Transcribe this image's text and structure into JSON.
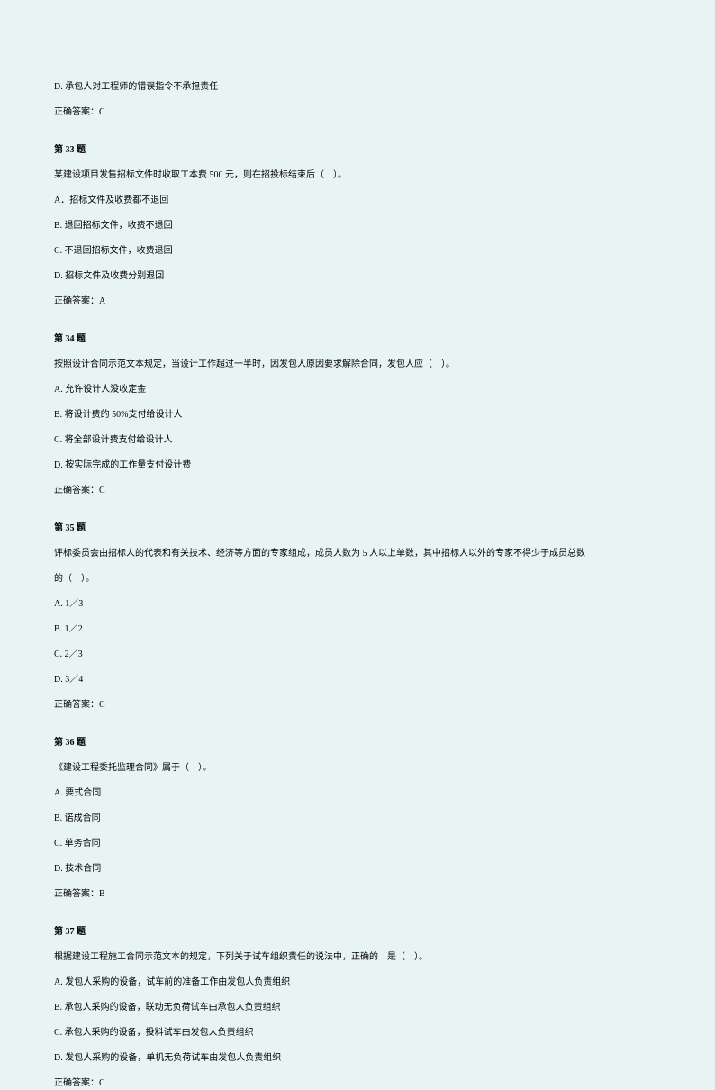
{
  "intro": {
    "optionD": "D. 承包人对工程师的错误指令不承担责任",
    "answer": "正确答案：C"
  },
  "q33": {
    "header": "第 33 题",
    "stem": "某建设项目发售招标文件时收取工本费 500 元，则在招投标结束后（　）。",
    "optA": "A．招标文件及收费都不退回",
    "optB": "B. 退回招标文件，收费不退回",
    "optC": "C. 不退回招标文件，收费退回",
    "optD": "D. 招标文件及收费分别退回",
    "answer": "正确答案：A"
  },
  "q34": {
    "header": "第 34 题",
    "stem": "按照设计合同示范文本规定，当设计工作超过一半时，因发包人原因要求解除合同，发包人应（　）。",
    "optA": "A. 允许设计人没收定金",
    "optB": "B. 将设计费的 50%支付给设计人",
    "optC": "C. 将全部设计费支付给设计人",
    "optD": "D. 按实际完成的工作量支付设计费",
    "answer": "正确答案：C"
  },
  "q35": {
    "header": "第 35 题",
    "stem1": "评标委员会由招标人的代表和有关技术、经济等方面的专家组成，成员人数为 5 人以上单数，其中招标人以外的专家不得少于成员总数",
    "stem2": "的（　）。",
    "optA": "A. 1／3",
    "optB": "B. 1／2",
    "optC": "C. 2／3",
    "optD": "D. 3／4",
    "answer": "正确答案：C"
  },
  "q36": {
    "header": "第 36 题",
    "stem": "《建设工程委托监理合同》属于（　）。",
    "optA": "A. 要式合同",
    "optB": "B. 诺成合同",
    "optC": "C. 单务合同",
    "optD": "D. 技术合同",
    "answer": "正确答案：B"
  },
  "q37": {
    "header": "第 37 题",
    "stem": "根据建设工程施工合同示范文本的规定，下列关于试车组织责任的说法中，正确的　是（　）。",
    "optA": "A. 发包人采购的设备，试车前的准备工作由发包人负责组织",
    "optB": "B. 承包人采购的设备，联动无负荷试车由承包人负责组织",
    "optC": "C. 承包人采购的设备，投料试车由发包人负责组织",
    "optD": "D. 发包人采购的设备，单机无负荷试车由发包人负责组织",
    "answer": "正确答案：C"
  }
}
